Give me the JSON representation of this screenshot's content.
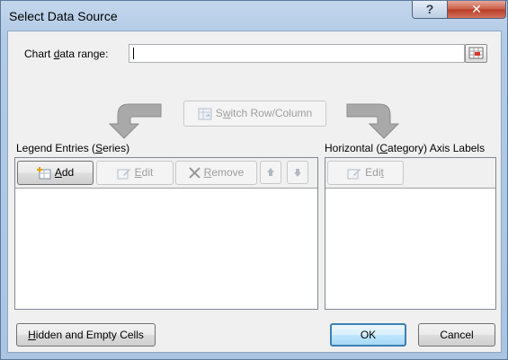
{
  "window": {
    "title": "Select Data Source",
    "help_label": "?",
    "close_label": "✕"
  },
  "range": {
    "label_pre": "Chart ",
    "label_key": "d",
    "label_post": "ata range:",
    "value": ""
  },
  "switch": {
    "label_pre": "S",
    "label_key": "w",
    "label_post": "itch Row/Column"
  },
  "legend": {
    "label_pre": "Legend Entries (",
    "label_key": "S",
    "label_post": "eries)",
    "add_label_key": "A",
    "add_label_post": "dd",
    "edit_label_key": "E",
    "edit_label_post": "dit",
    "remove_label_key": "R",
    "remove_label_post": "emove",
    "up_icon": "arrow-up",
    "down_icon": "arrow-down"
  },
  "axis": {
    "label_pre": "Horizontal (",
    "label_key": "C",
    "label_post": "ategory) Axis Labels",
    "edit_label_pre": "Edi",
    "edit_label_key": "t",
    "edit_label_post": ""
  },
  "footer": {
    "hidden_pre": "",
    "hidden_key": "H",
    "hidden_post": "idden and Empty Cells",
    "ok_label": "OK",
    "cancel_label": "Cancel"
  },
  "colors": {
    "title_bar": "#b3cbe6",
    "close_button": "#c85a44",
    "dialog_background": "#f0f0f0",
    "disabled_text": "#9d9d9d"
  }
}
